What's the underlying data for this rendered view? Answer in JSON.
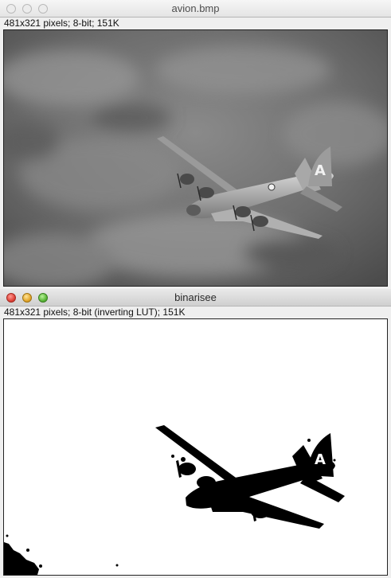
{
  "window_top": {
    "title": "avion.bmp",
    "info": "481x321 pixels; 8-bit; 151K",
    "image": {
      "description_icon": "airplane-photo-grayscale",
      "tail_letter": "A"
    }
  },
  "window_bottom": {
    "title": "binarisee",
    "info": "481x321 pixels; 8-bit (inverting LUT); 151K",
    "image": {
      "description_icon": "airplane-binary-silhouette",
      "tail_letter": "A"
    }
  },
  "colors": {
    "close": "#e0443a",
    "minimize": "#e4a72c",
    "maximize": "#5cb83a",
    "sky": "#6b6b6b",
    "plane": "#c8c8c8"
  }
}
